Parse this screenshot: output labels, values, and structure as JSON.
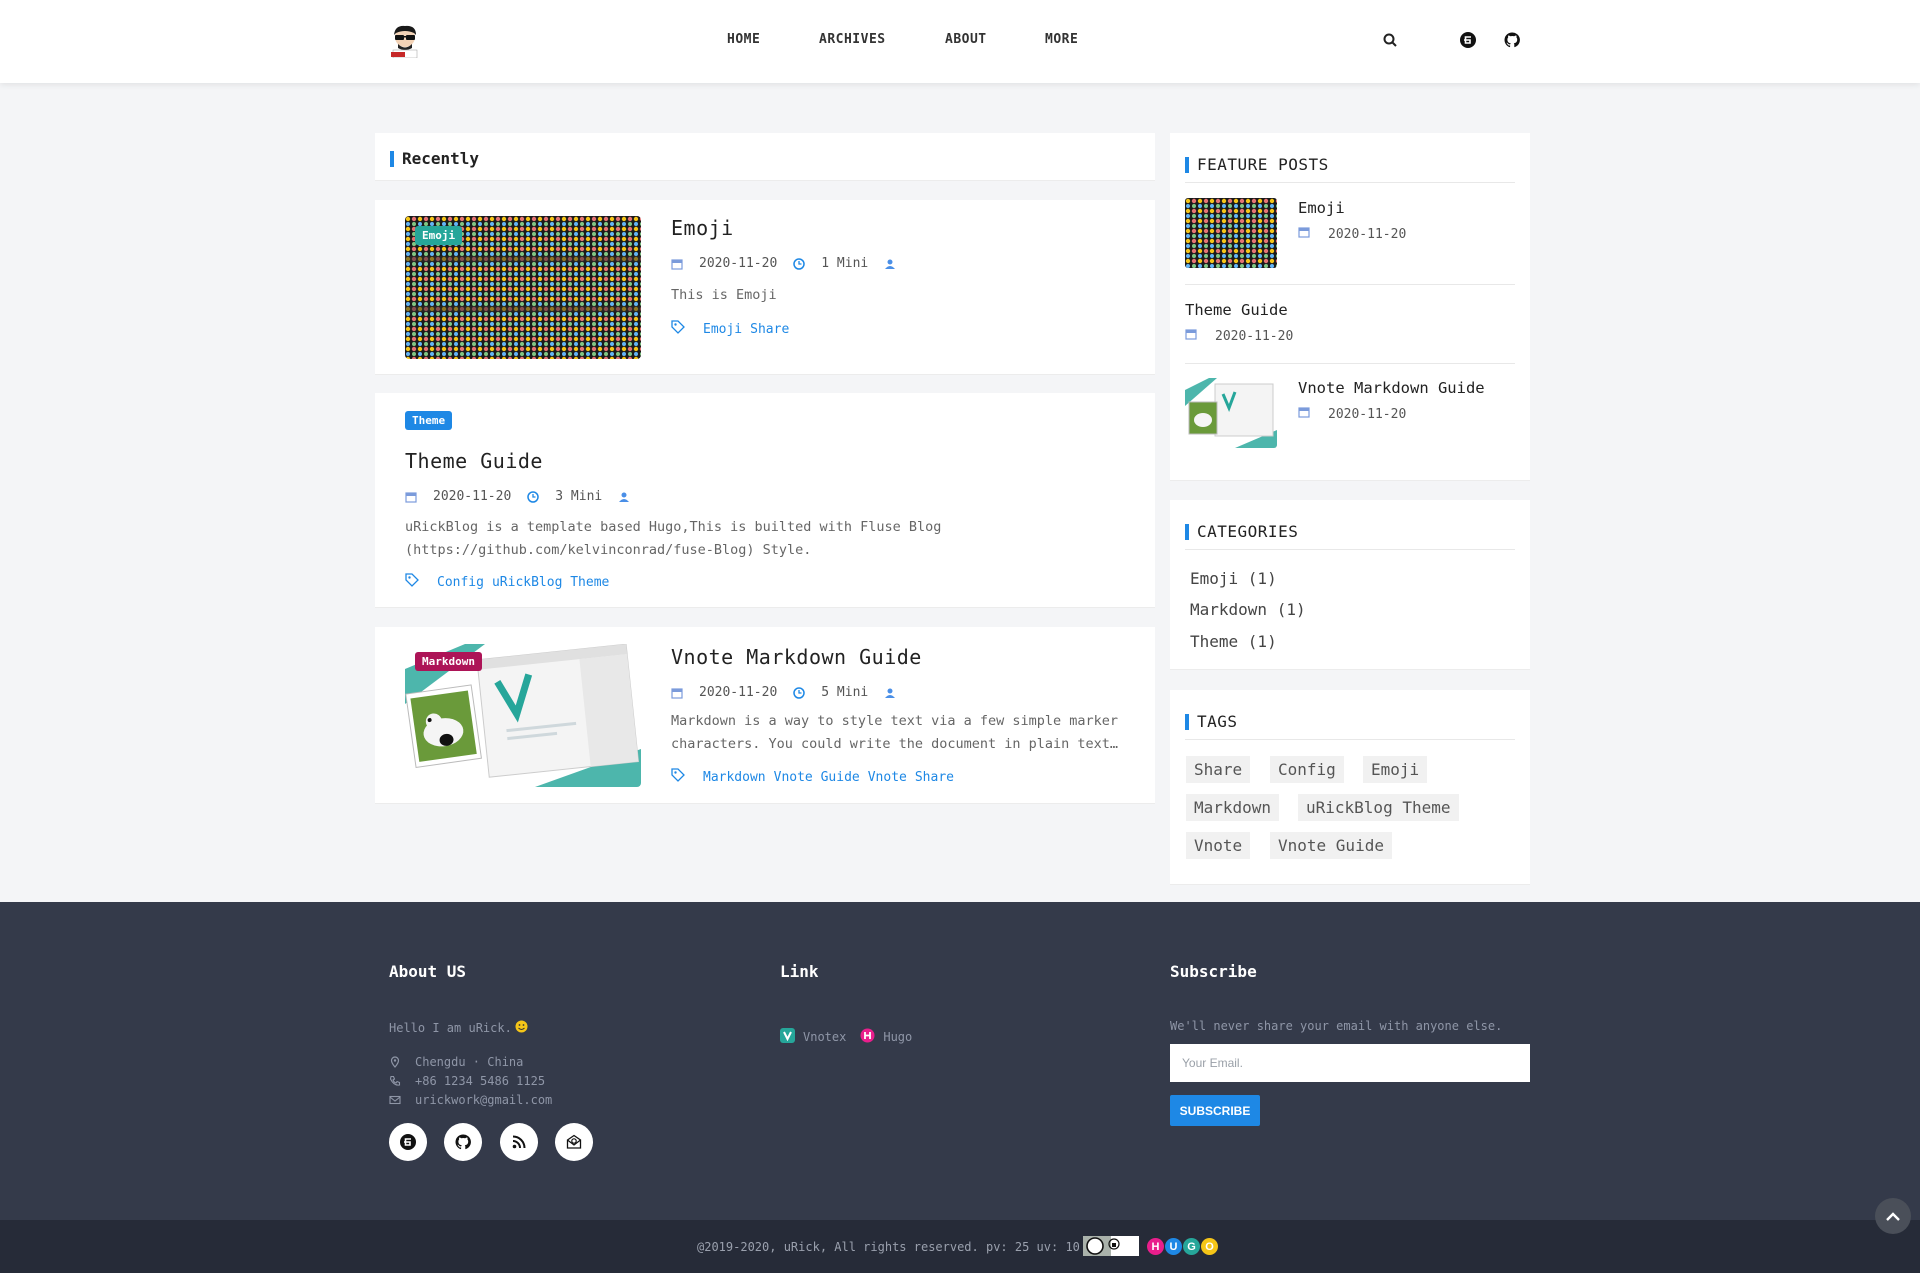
{
  "nav": {
    "home": "HOME",
    "archives": "ARCHIVES",
    "about": "ABOUT",
    "more": "MORE"
  },
  "recently": {
    "title": "Recently"
  },
  "posts": [
    {
      "badge": "Emoji",
      "badge_color": "#26a69a",
      "title": "Emoji",
      "date": "2020-11-20",
      "read_time": "1 Mini",
      "excerpt": "This is Emoji",
      "tags": [
        "Emoji",
        "Share"
      ]
    },
    {
      "badge": "Theme",
      "badge_color": "#1e88e5",
      "title": "Theme Guide",
      "date": "2020-11-20",
      "read_time": "3 Mini",
      "excerpt_line1": "uRickBlog is a template based Hugo,This is builted with Fluse Blog",
      "excerpt_line2": "(https://github.com/kelvinconrad/fuse-Blog) Style.",
      "tags": [
        "Config",
        "uRickBlog Theme"
      ]
    },
    {
      "badge": "Markdown",
      "badge_color": "#ad1457",
      "title": "Vnote Markdown Guide",
      "date": "2020-11-20",
      "read_time": "5 Mini",
      "excerpt_line1": "Markdown is a way to style text via a few simple marker",
      "excerpt_line2": "characters. You could write the document in plain text…",
      "tags": [
        "Markdown",
        "Vnote Guide",
        "Vnote",
        "Share"
      ]
    }
  ],
  "feature": {
    "title": "FEATURE POSTS",
    "items": [
      {
        "title": "Emoji",
        "date": "2020-11-20"
      },
      {
        "title": "Theme Guide",
        "date": "2020-11-20"
      },
      {
        "title": "Vnote Markdown Guide",
        "date": "2020-11-20"
      }
    ]
  },
  "categories": {
    "title": "CATEGORIES",
    "items": [
      "Emoji (1)",
      "Markdown (1)",
      "Theme (1)"
    ]
  },
  "tags": {
    "title": "TAGS",
    "items": [
      "Share",
      "Config",
      "Emoji",
      "Markdown",
      "uRickBlog Theme",
      "Vnote",
      "Vnote Guide"
    ]
  },
  "footer": {
    "about": {
      "title": "About US",
      "hello": "Hello I am uRick.",
      "location": "Chengdu · China",
      "phone": "+86 1234 5486 1125",
      "email": "urickwork@gmail.com"
    },
    "link": {
      "title": "Link",
      "items": [
        "Vnotex",
        "Hugo"
      ]
    },
    "subscribe": {
      "title": "Subscribe",
      "note": "We'll never share your email with anyone else.",
      "placeholder": "Your Email.",
      "button": "SUBSCRIBE"
    },
    "copyright": "@2019-2020, uRick, All rights reserved. pv: 25 uv: 10",
    "hugo_letters": [
      "H",
      "U",
      "G",
      "O"
    ]
  },
  "colors": {
    "accent": "#1e88e5",
    "footer_bg": "#343a4a",
    "bottom_bg": "#262b38"
  }
}
